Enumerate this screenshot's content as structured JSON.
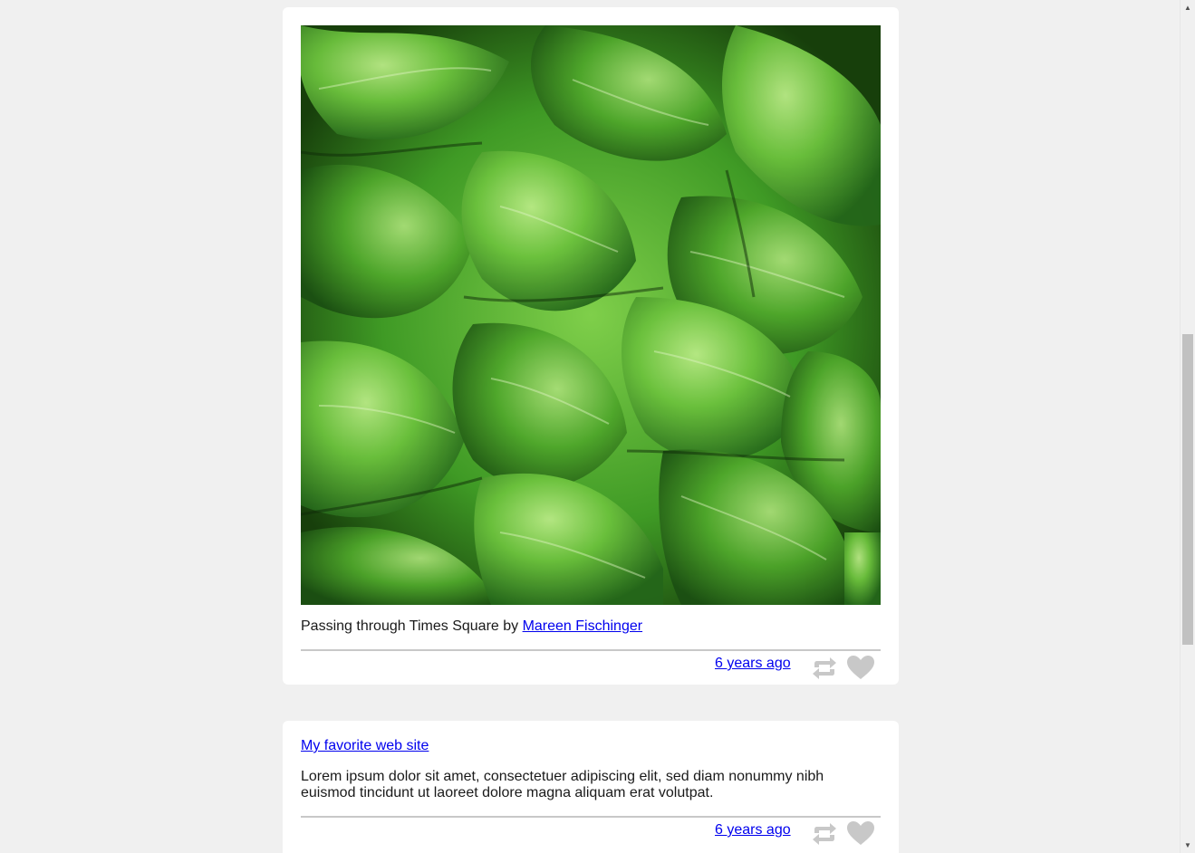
{
  "photo_post": {
    "image_alt": "Close-up photo of green lettuce leaves",
    "caption_text": "Passing through Times Square by ",
    "caption_author": "Mareen Fischinger",
    "timestamp": "6 years ago",
    "reblog_icon": "reblog-icon",
    "like_icon": "heart-icon"
  },
  "link_post": {
    "title": "My favorite web site",
    "body": "Lorem ipsum dolor sit amet, consectetuer adipiscing elit, sed diam nonummy nibh euismod tincidunt ut laoreet dolore magna aliquam erat volutpat.",
    "timestamp": "6 years ago",
    "reblog_icon": "reblog-icon",
    "like_icon": "heart-icon"
  },
  "colors": {
    "page_background": "#f0f0f0",
    "card_background": "#ffffff",
    "link": "#0000ee",
    "icon": "#c8c8c8"
  }
}
